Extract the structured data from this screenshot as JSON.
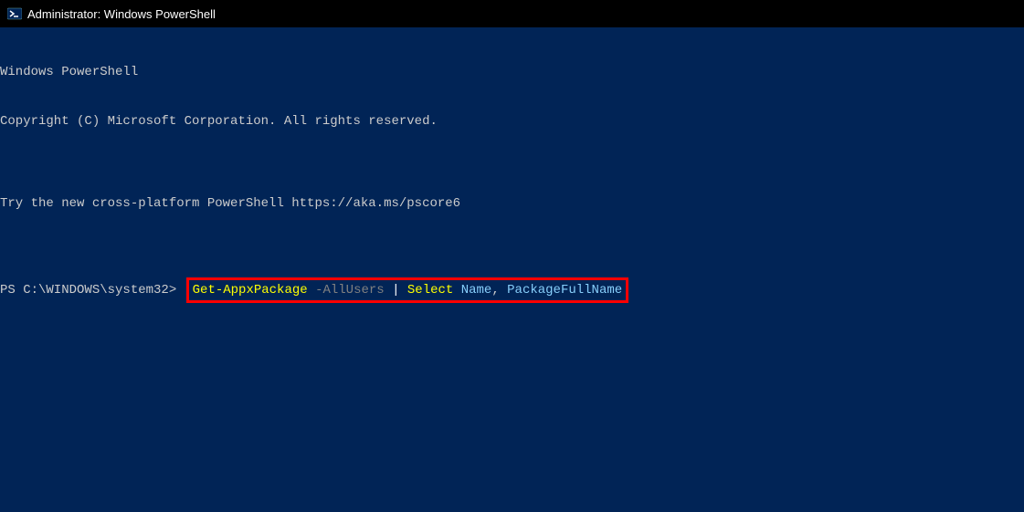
{
  "window": {
    "title": "Administrator: Windows PowerShell"
  },
  "terminal": {
    "header_line1": "Windows PowerShell",
    "header_line2": "Copyright (C) Microsoft Corporation. All rights reserved.",
    "blank": "",
    "try_line": "Try the new cross-platform PowerShell https://aka.ms/pscore6",
    "prompt": "PS C:\\WINDOWS\\system32> ",
    "command": {
      "cmdlet": "Get-AppxPackage",
      "param": " -AllUsers ",
      "pipe": "| ",
      "select": "Select ",
      "arg1": "Name",
      "comma": ", ",
      "arg2": "PackageFullName"
    }
  }
}
